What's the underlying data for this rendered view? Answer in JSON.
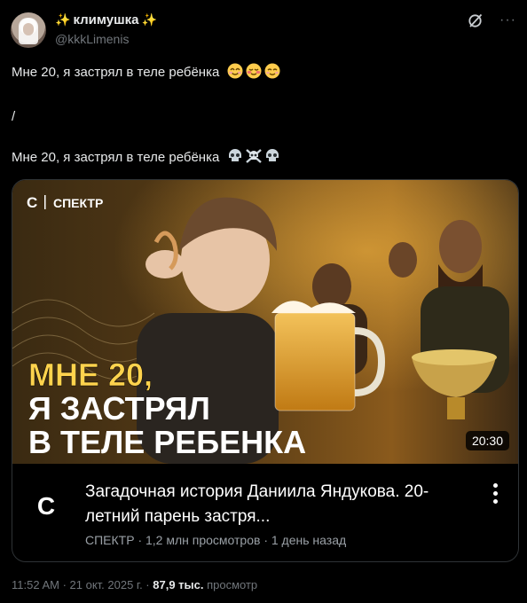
{
  "author": {
    "name": "климушка",
    "handle": "@kkkLimenis"
  },
  "tweet": {
    "line1": "Мне 20, я застрял в теле ребёнка",
    "separator": "/",
    "line2": "Мне 20, я застрял в теле ребёнка"
  },
  "card": {
    "brand": "СПЕКТР",
    "brand_letter": "С",
    "headline_line1": "МНЕ 20,",
    "headline_line2": "Я ЗАСТРЯЛ",
    "headline_line3": "В ТЕЛЕ РЕБЕНКА",
    "duration": "20:30",
    "title": "Загадочная история Даниила Яндукова. 20-летний парень застря...",
    "meta": "СПЕКТР · 1,2 млн просмотров · 1 день назад"
  },
  "footer": {
    "datetime": "11:52 AM · 21 окт. 2025 г. · ",
    "views": "87,9 тыс.",
    "views_label": " просмотр"
  },
  "colors": {
    "accent_text": "#f7c948",
    "headline": "#ffd34d",
    "background": "#000000"
  }
}
